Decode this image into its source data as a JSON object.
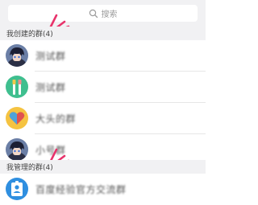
{
  "search": {
    "placeholder": "搜索",
    "icon": "search-icon"
  },
  "my_created_groups": {
    "title": "我创建的群(4)",
    "items": [
      {
        "label": "测试群",
        "avatar": "anime-boy-avatar"
      },
      {
        "label": "测试群",
        "avatar": "toothbrush-avatar"
      },
      {
        "label": "大头的群",
        "avatar": "heart-avatar"
      },
      {
        "label": "小号群",
        "avatar": "anime-boy-avatar"
      }
    ]
  },
  "my_managed_groups": {
    "title": "我管理的群(4)",
    "items": [
      {
        "label": "百度经验官方交流群",
        "avatar": "id-badge-avatar"
      }
    ]
  },
  "colors": {
    "section_bg": "#f1f1f3",
    "annotation_marker": "#e8336b"
  }
}
